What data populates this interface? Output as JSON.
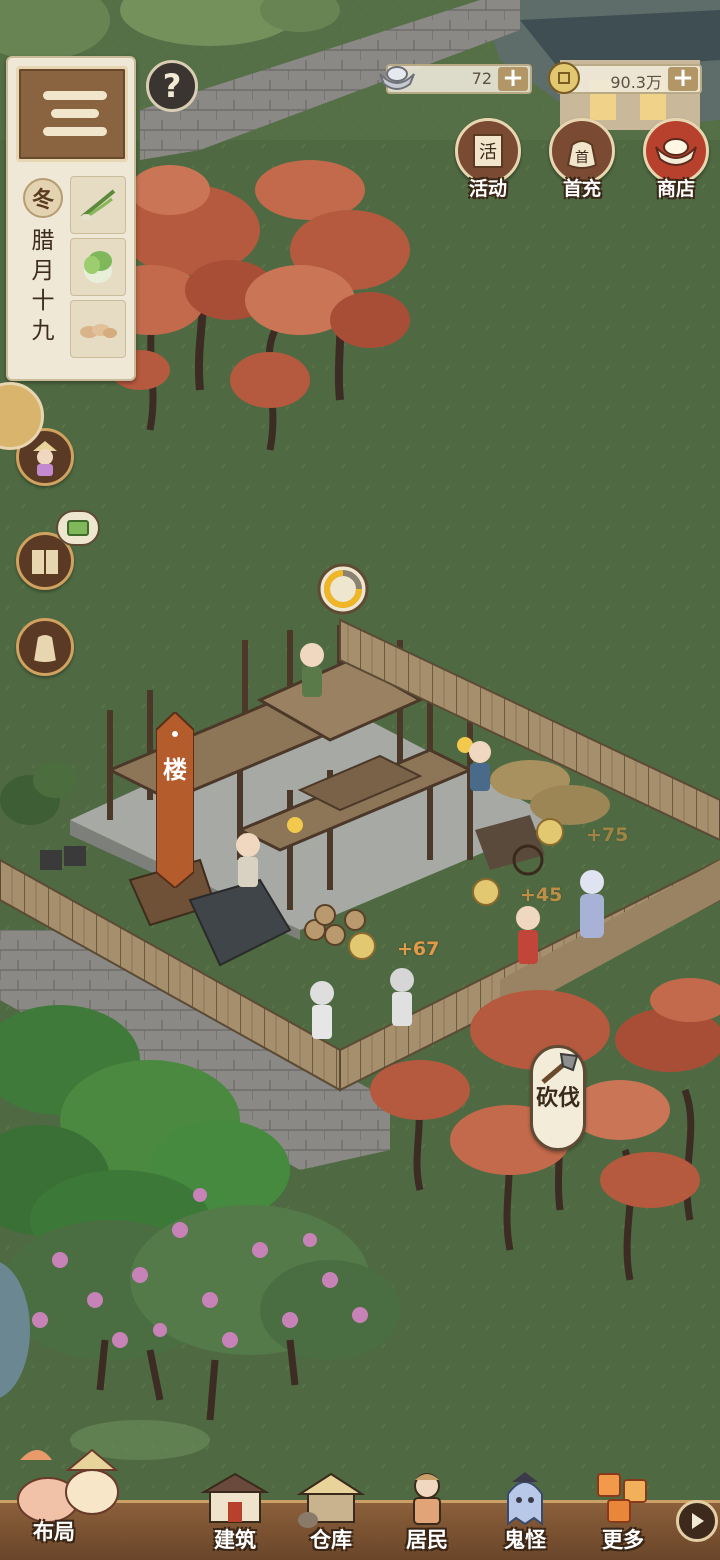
{
  "season": {
    "name": "冬",
    "date": "腊月十九"
  },
  "currency": {
    "silver": {
      "value": "72"
    },
    "coins": {
      "value": "90.3万"
    }
  },
  "top_buttons": [
    {
      "label": "活动",
      "icon_char": "活",
      "icon": "activity-scroll-icon"
    },
    {
      "label": "首充",
      "icon_char": "首",
      "icon": "first-recharge-bag-icon"
    },
    {
      "label": "商店",
      "icon": "shop-ingot-icon"
    }
  ],
  "building": {
    "banner": "楼"
  },
  "float_numbers": [
    "+67",
    "+45",
    "+75"
  ],
  "chop_bubble": {
    "label": "砍伐"
  },
  "bottom_nav": [
    {
      "label": "布局",
      "icon": "layout-pigs-icon"
    },
    {
      "label": "建筑",
      "icon": "building-house-icon"
    },
    {
      "label": "仓库",
      "icon": "warehouse-icon"
    },
    {
      "label": "居民",
      "icon": "resident-icon"
    },
    {
      "label": "鬼怪",
      "icon": "ghost-icon"
    },
    {
      "label": "更多",
      "icon": "more-lantern-icon"
    }
  ],
  "colors": {
    "grass": "#4f6a42",
    "path": "#8a8a86",
    "tree_red": "#c4664a",
    "ui_brown": "#8a6440",
    "float_orange": "#e39a48"
  }
}
